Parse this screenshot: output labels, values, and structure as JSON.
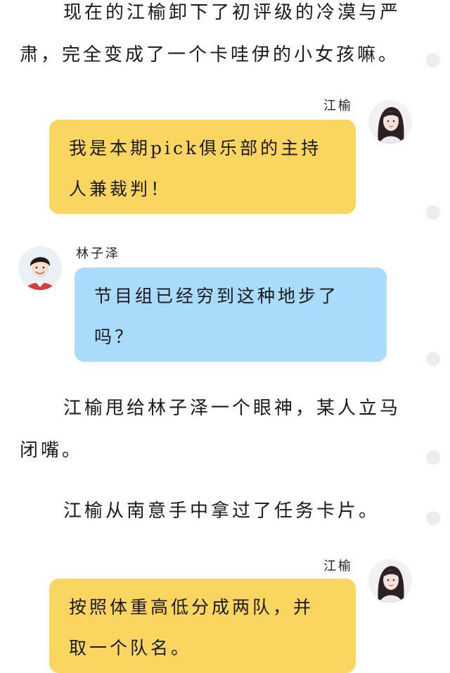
{
  "paragraphs": [
    {
      "line1": "现在的江榆卸下了初评级的冷漠与严",
      "line2": "肃，完全变成了一个卡哇伊的小女孩嘛。"
    },
    {
      "line1": "江榆甩给林子泽一个眼神，某人立马",
      "line2": "闭嘴。"
    },
    {
      "line1": "江榆从南意手中拿过了任务卡片。"
    }
  ],
  "chat": [
    {
      "speaker": "江榆",
      "line1": "我是本期pick俱乐部的主持",
      "line2": "人兼裁判！"
    },
    {
      "speaker": "林子泽",
      "line1": "节目组已经穷到这种地步了",
      "line2": "吗？"
    },
    {
      "speaker": "江榆",
      "line1": "按照体重高低分成两队，并",
      "line2": "取一个队名。"
    }
  ],
  "colors": {
    "bubble_yellow": "#fad55f",
    "bubble_blue": "#a8dcfa",
    "side_dot": "#ededed"
  }
}
